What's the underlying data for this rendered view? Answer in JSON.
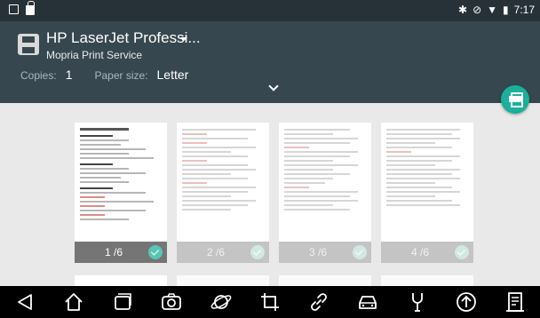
{
  "status_bar": {
    "time": "7:17"
  },
  "printer": {
    "name": "HP LaserJet Professi...",
    "service": "Mopria Print Service"
  },
  "options": {
    "copies_label": "Copies:",
    "copies_value": "1",
    "paper_size_label": "Paper size:",
    "paper_size_value": "Letter"
  },
  "pages": [
    {
      "label": "1 /6",
      "selected": true
    },
    {
      "label": "2 /6",
      "selected": false
    },
    {
      "label": "3 /6",
      "selected": false
    },
    {
      "label": "4 /6",
      "selected": false
    }
  ],
  "icons": {
    "nav": [
      "back-icon",
      "home-icon",
      "recent-apps-icon",
      "camera-icon",
      "browser-icon",
      "crop-icon",
      "link-icon",
      "car-icon",
      "tools-icon",
      "upload-icon",
      "report-icon"
    ]
  },
  "colors": {
    "header": "#37474f",
    "status_bar": "#273238",
    "accent": "#1ab09b",
    "nav_bar": "#000000"
  }
}
